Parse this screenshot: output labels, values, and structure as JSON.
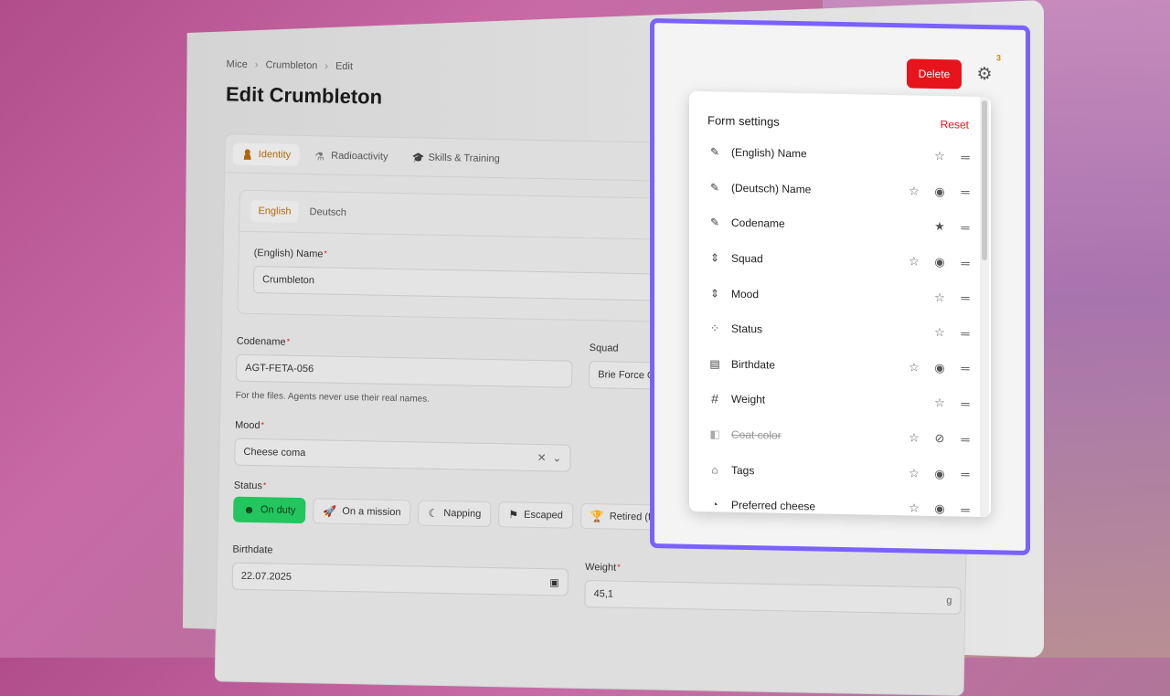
{
  "breadcrumb": [
    "Mice",
    "Crumbleton",
    "Edit"
  ],
  "page_title": "Edit Crumbleton",
  "tabs": [
    {
      "label": "Identity",
      "icon": "person-icon",
      "active": true
    },
    {
      "label": "Radioactivity",
      "icon": "flask-icon"
    },
    {
      "label": "Skills & Training",
      "icon": "graduation-cap-icon"
    }
  ],
  "lang_tabs": [
    {
      "label": "English",
      "active": true
    },
    {
      "label": "Deutsch"
    }
  ],
  "fields": {
    "english_name": {
      "label": "(English) Name",
      "value": "Crumbleton"
    },
    "codename": {
      "label": "Codename",
      "value": "AGT-FETA-056",
      "help": "For the files. Agents never use their real names."
    },
    "squad": {
      "label": "Squad",
      "value": "Brie Force One"
    },
    "mood": {
      "label": "Mood",
      "value": "Cheese coma"
    },
    "status": {
      "label": "Status",
      "options": [
        "On duty",
        "On a mission",
        "Napping",
        "Escaped",
        "Retired (farm upstate)"
      ]
    },
    "birthdate": {
      "label": "Birthdate",
      "value": "22.07.2025"
    },
    "weight": {
      "label": "Weight",
      "value": "45,1",
      "unit": "g"
    }
  },
  "header": {
    "delete_label": "Delete",
    "gear_badge": "3"
  },
  "form_settings": {
    "title": "Form settings",
    "reset_label": "Reset",
    "items": [
      {
        "label": "(English) Name",
        "icon": "pencil-icon"
      },
      {
        "label": "(Deutsch) Name",
        "icon": "pencil-icon"
      },
      {
        "label": "Codename",
        "icon": "pencil-icon"
      },
      {
        "label": "Squad",
        "icon": "select-icon"
      },
      {
        "label": "Mood",
        "icon": "select-icon"
      },
      {
        "label": "Status",
        "icon": "grid-icon"
      },
      {
        "label": "Birthdate",
        "icon": "calendar-icon"
      },
      {
        "label": "Weight",
        "icon": "hash-icon"
      },
      {
        "label": "Coat color",
        "icon": "palette-icon"
      },
      {
        "label": "Tags",
        "icon": "tag-icon"
      },
      {
        "label": "Preferred cheese",
        "icon": "cheese-icon"
      }
    ]
  },
  "colors": {
    "accent": "#7b61ff",
    "danger": "#e8141b",
    "success": "#22c55e",
    "tab_active": "#b0680a"
  }
}
